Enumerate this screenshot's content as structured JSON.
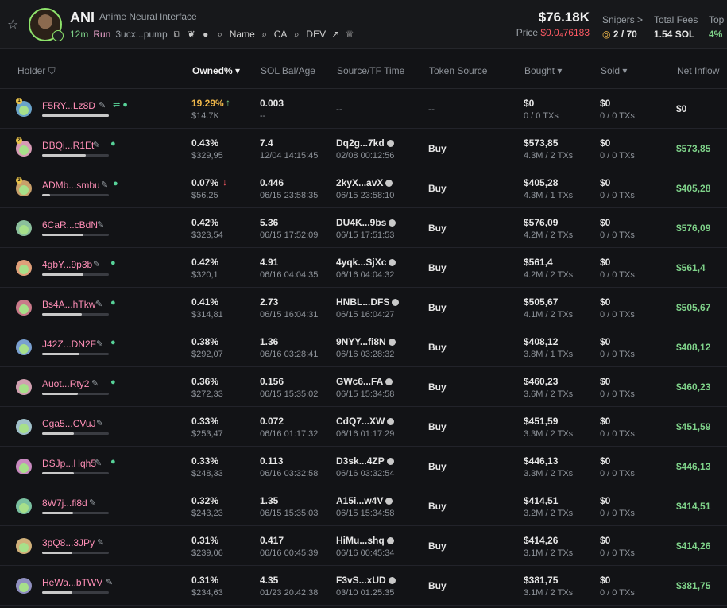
{
  "header": {
    "ticker": "ANI",
    "full_name": "Anime Neural Interface",
    "age": "12m",
    "run_label": "Run",
    "contract_short": "3ucx...pump",
    "tag_name": "Name",
    "tag_ca": "CA",
    "tag_dev": "DEV",
    "market_cap": "$76.18K",
    "price_label": "Price",
    "price_value": "$0.0₄76183",
    "snipers_label": "Snipers >",
    "snipers_value": "2 / 70",
    "fees_label": "Total Fees",
    "fees_value": "1.54 SOL",
    "top10_label": "Top",
    "top10_value": "4%"
  },
  "columns": {
    "holder": "Holder",
    "owned": "Owned%",
    "sol_bal_age": "SOL Bal/Age",
    "source_tf_time": "Source/TF Time",
    "token_source": "Token Source",
    "bought": "Bought",
    "sold": "Sold",
    "net_inflow": "Net Inflow"
  },
  "rows": [
    {
      "holder": "F5RY...Lz8D",
      "owned": "19.29%",
      "owned_usd": "$14.7K",
      "sol_bal": "0.003",
      "age": "--",
      "source": "--",
      "source_time": "",
      "token_source": "--",
      "bought": "$0",
      "bought_txs": "0 / 0 TXs",
      "sold": "$0",
      "sold_txs": "0 / 0 TXs",
      "net": "$0"
    },
    {
      "holder": "DBQi...R1Et",
      "owned": "0.43%",
      "owned_usd": "$329,95",
      "sol_bal": "7.4",
      "age": "12/04 14:15:45",
      "source": "Dq2g...7kd",
      "source_time": "02/08 00:12:56",
      "token_source": "Buy",
      "bought": "$573,85",
      "bought_txs": "4.3M / 2 TXs",
      "sold": "$0",
      "sold_txs": "0 / 0 TXs",
      "net": "$573,85"
    },
    {
      "holder": "ADMb...smbu",
      "owned": "0.07%",
      "owned_usd": "$56.25",
      "sol_bal": "0.446",
      "age": "06/15 23:58:35",
      "source": "2kyX...avX",
      "source_time": "06/15 23:58:10",
      "token_source": "Buy",
      "bought": "$405,28",
      "bought_txs": "4.3M / 1 TXs",
      "sold": "$0",
      "sold_txs": "0 / 0 TXs",
      "net": "$405,28"
    },
    {
      "holder": "6CaR...cBdN",
      "owned": "0.42%",
      "owned_usd": "$323,54",
      "sol_bal": "5.36",
      "age": "06/15 17:52:09",
      "source": "DU4K...9bs",
      "source_time": "06/15 17:51:53",
      "token_source": "Buy",
      "bought": "$576,09",
      "bought_txs": "4.2M / 2 TXs",
      "sold": "$0",
      "sold_txs": "0 / 0 TXs",
      "net": "$576,09"
    },
    {
      "holder": "4gbY...9p3b",
      "owned": "0.42%",
      "owned_usd": "$320,1",
      "sol_bal": "4.91",
      "age": "06/16 04:04:35",
      "source": "4yqk...SjXc",
      "source_time": "06/16 04:04:32",
      "token_source": "Buy",
      "bought": "$561,4",
      "bought_txs": "4.2M / 2 TXs",
      "sold": "$0",
      "sold_txs": "0 / 0 TXs",
      "net": "$561,4"
    },
    {
      "holder": "Bs4A...hTkw",
      "owned": "0.41%",
      "owned_usd": "$314,81",
      "sol_bal": "2.73",
      "age": "06/15 16:04:31",
      "source": "HNBL...DFS",
      "source_time": "06/15 16:04:27",
      "token_source": "Buy",
      "bought": "$505,67",
      "bought_txs": "4.1M / 2 TXs",
      "sold": "$0",
      "sold_txs": "0 / 0 TXs",
      "net": "$505,67"
    },
    {
      "holder": "J42Z...DN2F",
      "owned": "0.38%",
      "owned_usd": "$292,07",
      "sol_bal": "1.36",
      "age": "06/16 03:28:41",
      "source": "9NYY...fi8N",
      "source_time": "06/16 03:28:32",
      "token_source": "Buy",
      "bought": "$408,12",
      "bought_txs": "3.8M / 1 TXs",
      "sold": "$0",
      "sold_txs": "0 / 0 TXs",
      "net": "$408,12"
    },
    {
      "holder": "Auot...Rty2",
      "owned": "0.36%",
      "owned_usd": "$272,33",
      "sol_bal": "0.156",
      "age": "06/15 15:35:02",
      "source": "GWc6...FA",
      "source_time": "06/15 15:34:58",
      "token_source": "Buy",
      "bought": "$460,23",
      "bought_txs": "3.6M / 2 TXs",
      "sold": "$0",
      "sold_txs": "0 / 0 TXs",
      "net": "$460,23"
    },
    {
      "holder": "Cga5...CVuJ",
      "owned": "0.33%",
      "owned_usd": "$253,47",
      "sol_bal": "0.072",
      "age": "06/16 01:17:32",
      "source": "CdQ7...XW",
      "source_time": "06/16 01:17:29",
      "token_source": "Buy",
      "bought": "$451,59",
      "bought_txs": "3.3M / 2 TXs",
      "sold": "$0",
      "sold_txs": "0 / 0 TXs",
      "net": "$451,59"
    },
    {
      "holder": "DSJp...Hqh5",
      "owned": "0.33%",
      "owned_usd": "$248,33",
      "sol_bal": "0.113",
      "age": "06/16 03:32:58",
      "source": "D3sk...4ZP",
      "source_time": "06/16 03:32:54",
      "token_source": "Buy",
      "bought": "$446,13",
      "bought_txs": "3.3M / 2 TXs",
      "sold": "$0",
      "sold_txs": "0 / 0 TXs",
      "net": "$446,13"
    },
    {
      "holder": "8W7j...fi8d",
      "owned": "0.32%",
      "owned_usd": "$243,23",
      "sol_bal": "1.35",
      "age": "06/15 15:35:03",
      "source": "A15i...w4V",
      "source_time": "06/15 15:34:58",
      "token_source": "Buy",
      "bought": "$414,51",
      "bought_txs": "3.2M / 2 TXs",
      "sold": "$0",
      "sold_txs": "0 / 0 TXs",
      "net": "$414,51"
    },
    {
      "holder": "3pQ8...3JPy",
      "owned": "0.31%",
      "owned_usd": "$239,06",
      "sol_bal": "0.417",
      "age": "06/16 00:45:39",
      "source": "HiMu...shq",
      "source_time": "06/16 00:45:34",
      "token_source": "Buy",
      "bought": "$414,26",
      "bought_txs": "3.1M / 2 TXs",
      "sold": "$0",
      "sold_txs": "0 / 0 TXs",
      "net": "$414,26"
    },
    {
      "holder": "HeWa...bTWV",
      "owned": "0.31%",
      "owned_usd": "$234,63",
      "sol_bal": "4.35",
      "age": "01/23 20:42:38",
      "source": "F3vS...xUD",
      "source_time": "03/10 01:25:35",
      "token_source": "Buy",
      "bought": "$381,75",
      "bought_txs": "3.1M / 2 TXs",
      "sold": "$0",
      "sold_txs": "0 / 0 TXs",
      "net": "$381,75"
    }
  ],
  "colors": {
    "background": "#121316",
    "address": "#ff8fb7",
    "positive": "#7fd38a",
    "negative": "#ff5a64",
    "highlight": "#f0b84a"
  },
  "icons": [
    "star-icon",
    "copy-icon",
    "leaf-icon",
    "search-icon",
    "external-link-icon",
    "crown-icon",
    "filter-icon",
    "edit-icon",
    "user-icon",
    "arrow-up-icon",
    "arrow-down-icon",
    "coin-icon"
  ]
}
